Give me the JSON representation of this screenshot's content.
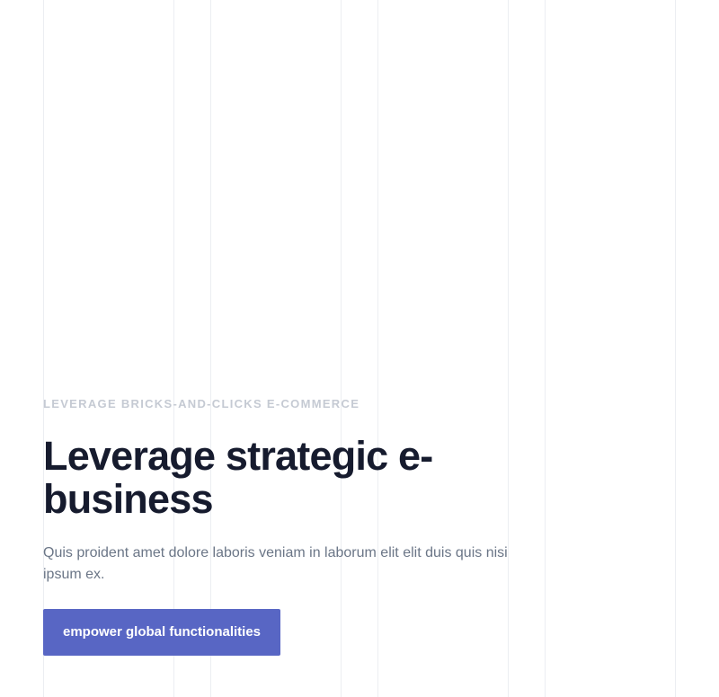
{
  "hero": {
    "eyebrow": "LEVERAGE BRICKS-AND-CLICKS E-COMMERCE",
    "title": "Leverage strategic e-business",
    "subtitle": "Quis proident amet dolore laboris veniam in laborum elit elit duis quis nisi ipsum ex.",
    "cta_label": "empower global functionalities"
  },
  "colors": {
    "accent": "#5866c4",
    "heading": "#161b2e",
    "body_text": "#6b7687",
    "eyebrow": "#c5cad3",
    "grid_line": "#eceef2"
  }
}
